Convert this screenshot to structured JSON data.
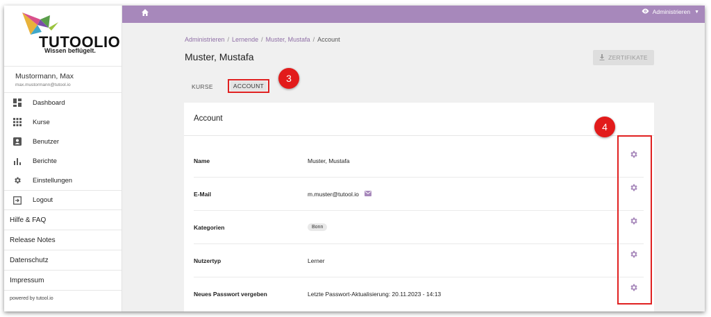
{
  "brand": {
    "logo_text": "TUTOOLIO",
    "tagline": "Wissen beflügelt."
  },
  "user": {
    "name": "Mustormann, Max",
    "email": "max.mustormann@tutool.io"
  },
  "sidebar": {
    "nav": [
      {
        "label": "Dashboard",
        "icon": "dashboard-icon"
      },
      {
        "label": "Kurse",
        "icon": "grid-icon"
      },
      {
        "label": "Benutzer",
        "icon": "contact-card-icon"
      },
      {
        "label": "Berichte",
        "icon": "bar-chart-icon"
      },
      {
        "label": "Einstellungen",
        "icon": "gear-icon"
      },
      {
        "label": "Logout",
        "icon": "logout-icon"
      }
    ],
    "links": [
      "Hilfe & FAQ",
      "Release Notes",
      "Datenschutz",
      "Impressum"
    ],
    "powered_by": "powered by tutool.io"
  },
  "topbar": {
    "role_label": "Administrieren",
    "accent_color": "#a788bb"
  },
  "breadcrumb": [
    "Administrieren",
    "Lernende",
    "Muster, Mustafa",
    "Account"
  ],
  "page_title": "Muster, Mustafa",
  "certificate_button": "ZERTIFIKATE",
  "tabs": [
    {
      "label": "KURSE",
      "active": false
    },
    {
      "label": "ACCOUNT",
      "active": true
    }
  ],
  "markers": [
    "3",
    "4"
  ],
  "card": {
    "title": "Account",
    "rows": [
      {
        "label": "Name",
        "value": "Muster, Mustafa"
      },
      {
        "label": "E-Mail",
        "value": "m.muster@tutool.io"
      },
      {
        "label": "Kategorien",
        "value": "Bonn"
      },
      {
        "label": "Nutzertyp",
        "value": "Lerner"
      },
      {
        "label": "Neues Passwort vergeben",
        "value": "Letzte Passwort-Aktualisierung: 20.11.2023 - 14:13"
      }
    ]
  }
}
